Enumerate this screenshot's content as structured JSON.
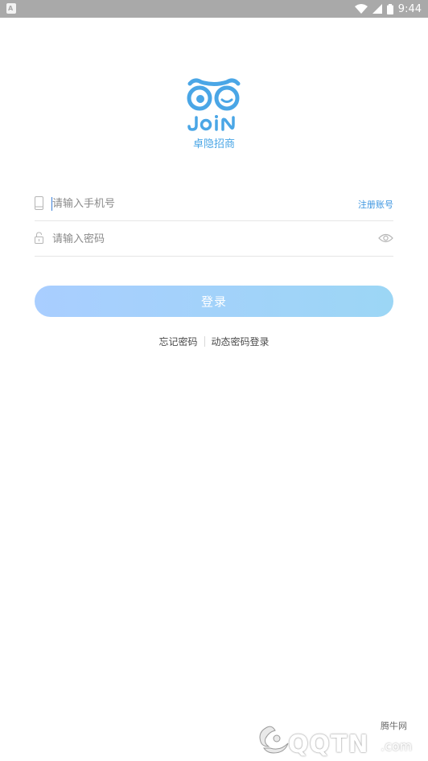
{
  "status_bar": {
    "time": "9:44"
  },
  "app": {
    "name": "卓隐招商",
    "logo_word": "JoiN"
  },
  "login_form": {
    "phone_placeholder": "请输入手机号",
    "register_label": "注册账号",
    "password_placeholder": "请输入密码",
    "login_label": "登录"
  },
  "links": {
    "forgot_password": "忘记密码",
    "dynamic_login": "动态密码登录"
  },
  "watermark": {
    "brand": "腾牛网",
    "text": "QQTN",
    "suffix": ".com"
  },
  "colors": {
    "accent": "#3c95e0",
    "button_start": "#a9ceff",
    "button_end": "#9cd6f5",
    "logo": "#4aa6e6"
  },
  "icons": [
    "phone-icon",
    "lock-icon",
    "eye-icon",
    "wifi-icon",
    "signal-icon",
    "battery-icon"
  ]
}
